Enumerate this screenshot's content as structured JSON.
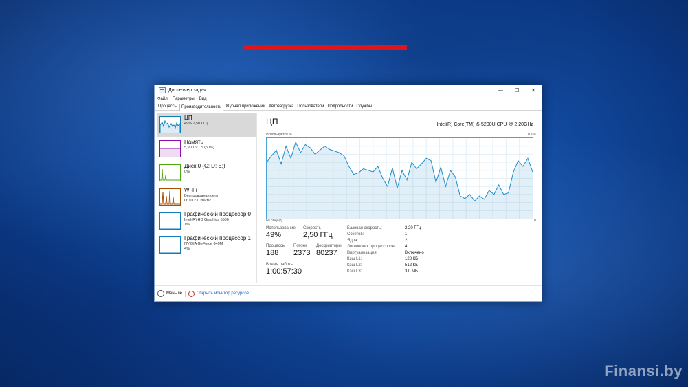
{
  "watermark": "Finansi.by",
  "window": {
    "title": "Диспетчер задач",
    "controls": {
      "minimize": "—",
      "maximize": "☐",
      "close": "✕"
    },
    "menu": [
      "Файл",
      "Параметры",
      "Вид"
    ],
    "tabs": [
      "Процессы",
      "Производительность",
      "Журнал приложений",
      "Автозагрузка",
      "Пользователи",
      "Подробности",
      "Службы"
    ],
    "active_tab": "Производительность"
  },
  "sidebar": {
    "items": [
      {
        "name": "ЦП",
        "sub1": "49% 2,50 ГГц",
        "sub2": "",
        "color": "#117dbb"
      },
      {
        "name": "Память",
        "sub1": "5,9/11,9 ГБ (50%)",
        "sub2": "",
        "color": "#8b12ae"
      },
      {
        "name": "Диск 0 (C: D: E:)",
        "sub1": "0%",
        "sub2": "",
        "color": "#4da60c"
      },
      {
        "name": "Wi-Fi",
        "sub1": "Беспроводная сеть",
        "sub2": "О: 0 П: 0 кбит/с",
        "color": "#a74f01"
      },
      {
        "name": "Графический процессор 0",
        "sub1": "Intel(R) HD Graphics 5500",
        "sub2": "1%",
        "color": "#117dbb"
      },
      {
        "name": "Графический процессор 1",
        "sub1": "NVIDIA GeForce 840M",
        "sub2": "4%",
        "color": "#117dbb"
      }
    ]
  },
  "main": {
    "heading": "ЦП",
    "cpu_model": "Intel(R) Core(TM) i5-5200U CPU @ 2.20GHz",
    "graph_label": "Используется %",
    "graph_max": "100%",
    "graph_time": "60 секунд",
    "graph_min": "0",
    "stats": {
      "usage_label": "Использование",
      "usage_value": "49%",
      "speed_label": "Скорость",
      "speed_value": "2,50 ГГц",
      "processes_label": "Процессы",
      "processes_value": "188",
      "threads_label": "Потоки",
      "threads_value": "2373",
      "handles_label": "Дескрипторы",
      "handles_value": "80237",
      "uptime_label": "Время работы",
      "uptime_value": "1:00:57:30"
    },
    "details": [
      {
        "k": "Базовая скорость:",
        "v": "2,20 ГГц"
      },
      {
        "k": "Сокетов:",
        "v": "1"
      },
      {
        "k": "Ядра:",
        "v": "2"
      },
      {
        "k": "Логических процессоров:",
        "v": "4"
      },
      {
        "k": "Виртуализация:",
        "v": "Включено"
      },
      {
        "k": "Кэш L1:",
        "v": "128 КБ"
      },
      {
        "k": "Кэш L2:",
        "v": "512 КБ"
      },
      {
        "k": "Кэш L3:",
        "v": "3,0 МБ"
      }
    ]
  },
  "footer": {
    "fewer": "Меньше",
    "monitor": "Открыть монитор ресурсов"
  },
  "chart_data": {
    "type": "area",
    "ylabel": "Используется %",
    "xlabel": "60 секунд",
    "ylim": [
      0,
      100
    ],
    "values": [
      70,
      78,
      85,
      68,
      90,
      75,
      95,
      82,
      92,
      88,
      80,
      85,
      90,
      86,
      84,
      82,
      78,
      65,
      55,
      57,
      62,
      60,
      58,
      65,
      50,
      40,
      63,
      38,
      60,
      48,
      70,
      62,
      68,
      75,
      72,
      45,
      64,
      40,
      60,
      52,
      28,
      25,
      30,
      22,
      28,
      24,
      35,
      30,
      42,
      30,
      32,
      58,
      72,
      65,
      75,
      58
    ]
  }
}
